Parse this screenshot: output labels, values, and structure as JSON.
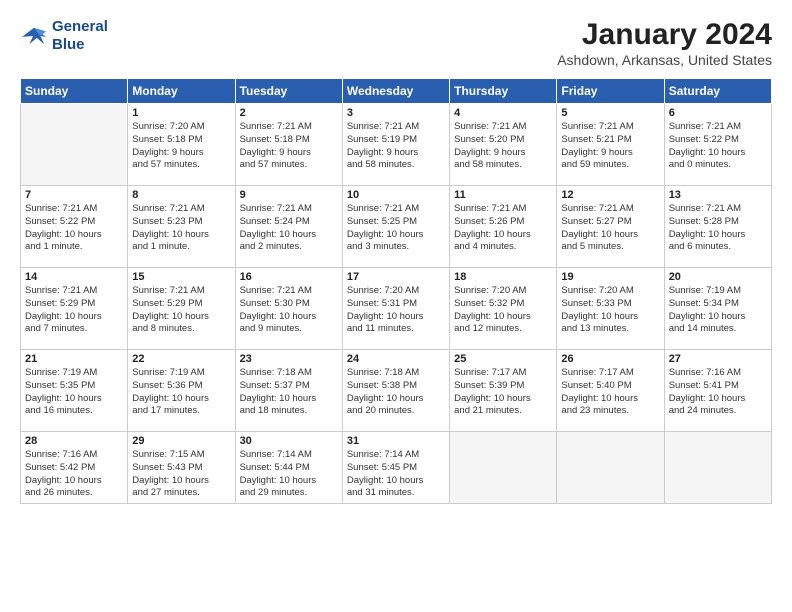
{
  "header": {
    "logo_line1": "General",
    "logo_line2": "Blue",
    "title": "January 2024",
    "subtitle": "Ashdown, Arkansas, United States"
  },
  "days_of_week": [
    "Sunday",
    "Monday",
    "Tuesday",
    "Wednesday",
    "Thursday",
    "Friday",
    "Saturday"
  ],
  "weeks": [
    [
      {
        "num": "",
        "info": ""
      },
      {
        "num": "1",
        "info": "Sunrise: 7:20 AM\nSunset: 5:18 PM\nDaylight: 9 hours\nand 57 minutes."
      },
      {
        "num": "2",
        "info": "Sunrise: 7:21 AM\nSunset: 5:18 PM\nDaylight: 9 hours\nand 57 minutes."
      },
      {
        "num": "3",
        "info": "Sunrise: 7:21 AM\nSunset: 5:19 PM\nDaylight: 9 hours\nand 58 minutes."
      },
      {
        "num": "4",
        "info": "Sunrise: 7:21 AM\nSunset: 5:20 PM\nDaylight: 9 hours\nand 58 minutes."
      },
      {
        "num": "5",
        "info": "Sunrise: 7:21 AM\nSunset: 5:21 PM\nDaylight: 9 hours\nand 59 minutes."
      },
      {
        "num": "6",
        "info": "Sunrise: 7:21 AM\nSunset: 5:22 PM\nDaylight: 10 hours\nand 0 minutes."
      }
    ],
    [
      {
        "num": "7",
        "info": "Sunrise: 7:21 AM\nSunset: 5:22 PM\nDaylight: 10 hours\nand 1 minute."
      },
      {
        "num": "8",
        "info": "Sunrise: 7:21 AM\nSunset: 5:23 PM\nDaylight: 10 hours\nand 1 minute."
      },
      {
        "num": "9",
        "info": "Sunrise: 7:21 AM\nSunset: 5:24 PM\nDaylight: 10 hours\nand 2 minutes."
      },
      {
        "num": "10",
        "info": "Sunrise: 7:21 AM\nSunset: 5:25 PM\nDaylight: 10 hours\nand 3 minutes."
      },
      {
        "num": "11",
        "info": "Sunrise: 7:21 AM\nSunset: 5:26 PM\nDaylight: 10 hours\nand 4 minutes."
      },
      {
        "num": "12",
        "info": "Sunrise: 7:21 AM\nSunset: 5:27 PM\nDaylight: 10 hours\nand 5 minutes."
      },
      {
        "num": "13",
        "info": "Sunrise: 7:21 AM\nSunset: 5:28 PM\nDaylight: 10 hours\nand 6 minutes."
      }
    ],
    [
      {
        "num": "14",
        "info": "Sunrise: 7:21 AM\nSunset: 5:29 PM\nDaylight: 10 hours\nand 7 minutes."
      },
      {
        "num": "15",
        "info": "Sunrise: 7:21 AM\nSunset: 5:29 PM\nDaylight: 10 hours\nand 8 minutes."
      },
      {
        "num": "16",
        "info": "Sunrise: 7:21 AM\nSunset: 5:30 PM\nDaylight: 10 hours\nand 9 minutes."
      },
      {
        "num": "17",
        "info": "Sunrise: 7:20 AM\nSunset: 5:31 PM\nDaylight: 10 hours\nand 11 minutes."
      },
      {
        "num": "18",
        "info": "Sunrise: 7:20 AM\nSunset: 5:32 PM\nDaylight: 10 hours\nand 12 minutes."
      },
      {
        "num": "19",
        "info": "Sunrise: 7:20 AM\nSunset: 5:33 PM\nDaylight: 10 hours\nand 13 minutes."
      },
      {
        "num": "20",
        "info": "Sunrise: 7:19 AM\nSunset: 5:34 PM\nDaylight: 10 hours\nand 14 minutes."
      }
    ],
    [
      {
        "num": "21",
        "info": "Sunrise: 7:19 AM\nSunset: 5:35 PM\nDaylight: 10 hours\nand 16 minutes."
      },
      {
        "num": "22",
        "info": "Sunrise: 7:19 AM\nSunset: 5:36 PM\nDaylight: 10 hours\nand 17 minutes."
      },
      {
        "num": "23",
        "info": "Sunrise: 7:18 AM\nSunset: 5:37 PM\nDaylight: 10 hours\nand 18 minutes."
      },
      {
        "num": "24",
        "info": "Sunrise: 7:18 AM\nSunset: 5:38 PM\nDaylight: 10 hours\nand 20 minutes."
      },
      {
        "num": "25",
        "info": "Sunrise: 7:17 AM\nSunset: 5:39 PM\nDaylight: 10 hours\nand 21 minutes."
      },
      {
        "num": "26",
        "info": "Sunrise: 7:17 AM\nSunset: 5:40 PM\nDaylight: 10 hours\nand 23 minutes."
      },
      {
        "num": "27",
        "info": "Sunrise: 7:16 AM\nSunset: 5:41 PM\nDaylight: 10 hours\nand 24 minutes."
      }
    ],
    [
      {
        "num": "28",
        "info": "Sunrise: 7:16 AM\nSunset: 5:42 PM\nDaylight: 10 hours\nand 26 minutes."
      },
      {
        "num": "29",
        "info": "Sunrise: 7:15 AM\nSunset: 5:43 PM\nDaylight: 10 hours\nand 27 minutes."
      },
      {
        "num": "30",
        "info": "Sunrise: 7:14 AM\nSunset: 5:44 PM\nDaylight: 10 hours\nand 29 minutes."
      },
      {
        "num": "31",
        "info": "Sunrise: 7:14 AM\nSunset: 5:45 PM\nDaylight: 10 hours\nand 31 minutes."
      },
      {
        "num": "",
        "info": ""
      },
      {
        "num": "",
        "info": ""
      },
      {
        "num": "",
        "info": ""
      }
    ]
  ]
}
